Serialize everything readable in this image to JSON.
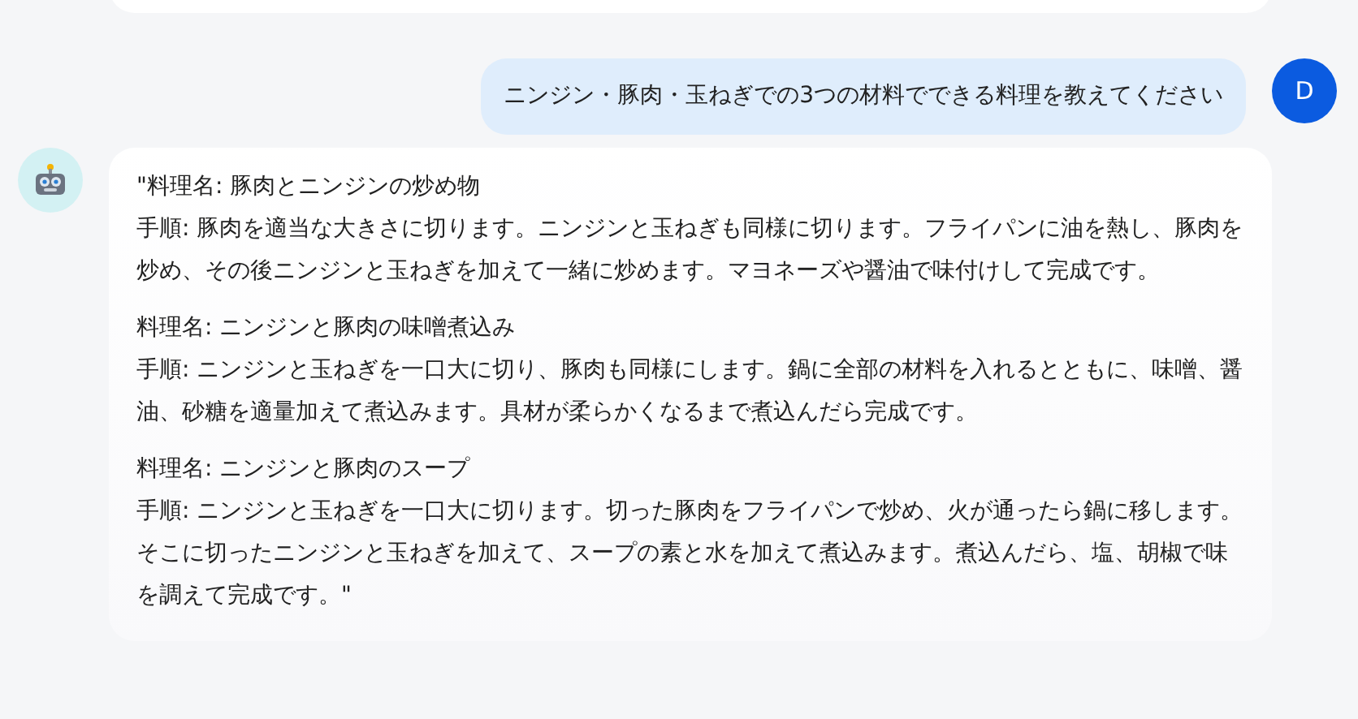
{
  "user_message": {
    "text": "ニンジン・豚肉・玉ねぎでの3つの材料でできる料理を教えてください",
    "avatar": "D"
  },
  "bot_message": {
    "recipes": [
      {
        "name": "\"料理名: 豚肉とニンジンの炒め物",
        "steps": "手順: 豚肉を適当な大きさに切ります。ニンジンと玉ねぎも同様に切ります。フライパンに油を熱し、豚肉を炒め、その後ニンジンと玉ねぎを加えて一緒に炒めます。マヨネーズや醤油で味付けして完成です。"
      },
      {
        "name": "料理名: ニンジンと豚肉の味噌煮込み",
        "steps": "手順: ニンジンと玉ねぎを一口大に切り、豚肉も同様にします。鍋に全部の材料を入れるとともに、味噌、醤油、砂糖を適量加えて煮込みます。具材が柔らかくなるまで煮込んだら完成です。"
      },
      {
        "name": "料理名: ニンジンと豚肉のスープ",
        "steps": "手順: ニンジンと玉ねぎを一口大に切ります。切った豚肉をフライパンで炒め、火が通ったら鍋に移します。そこに切ったニンジンと玉ねぎを加えて、スープの素と水を加えて煮込みます。煮込んだら、塩、胡椒で味を調えて完成です。\""
      }
    ]
  }
}
